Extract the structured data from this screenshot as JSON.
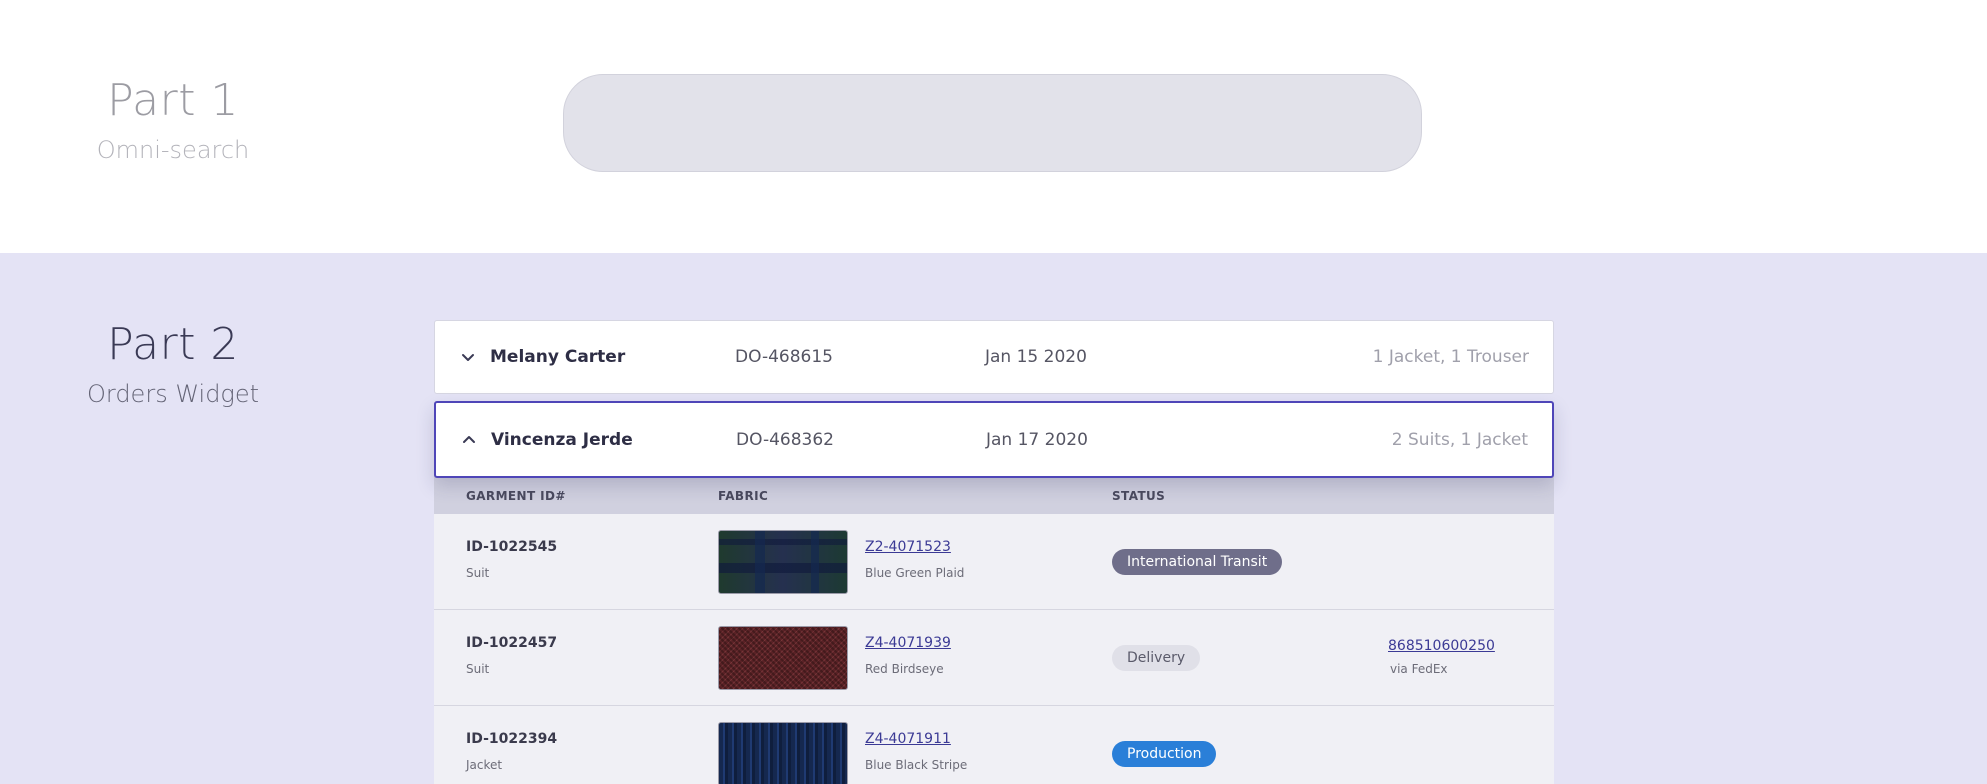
{
  "part1": {
    "title": "Part 1",
    "subtitle": "Omni-search"
  },
  "part2": {
    "title": "Part 2",
    "subtitle": "Orders Widget"
  },
  "orders": [
    {
      "name": "Melany Carter",
      "order_id": "DO-468615",
      "date": "Jan 15 2020",
      "summary": "1 Jacket, 1 Trouser",
      "expanded": false
    },
    {
      "name": "Vincenza Jerde",
      "order_id": "DO-468362",
      "date": "Jan 17 2020",
      "summary": "2 Suits, 1 Jacket",
      "expanded": true
    }
  ],
  "garment_table": {
    "headers": {
      "garment": "GARMENT ID#",
      "fabric": "FABRIC",
      "status": "STATUS"
    },
    "rows": [
      {
        "id": "ID-1022545",
        "type": "Suit",
        "fabric_code": "Z2-4071523",
        "fabric_name": "Blue Green Plaid",
        "status": "International Transit",
        "status_color": "#6f6e8a"
      },
      {
        "id": "ID-1022457",
        "type": "Suit",
        "fabric_code": "Z4-4071939",
        "fabric_name": "Red Birdseye",
        "status": "Delivery",
        "status_color": "#e0e0e8",
        "tracking": "868510600250",
        "carrier": "via FedEx"
      },
      {
        "id": "ID-1022394",
        "type": "Jacket",
        "fabric_code": "Z4-4071911",
        "fabric_name": "Blue Black Stripe",
        "status": "Production",
        "status_color": "#2a7fd8"
      }
    ]
  },
  "icons": {
    "collapsed": "chevron-down-icon",
    "expanded": "chevron-up-icon"
  }
}
